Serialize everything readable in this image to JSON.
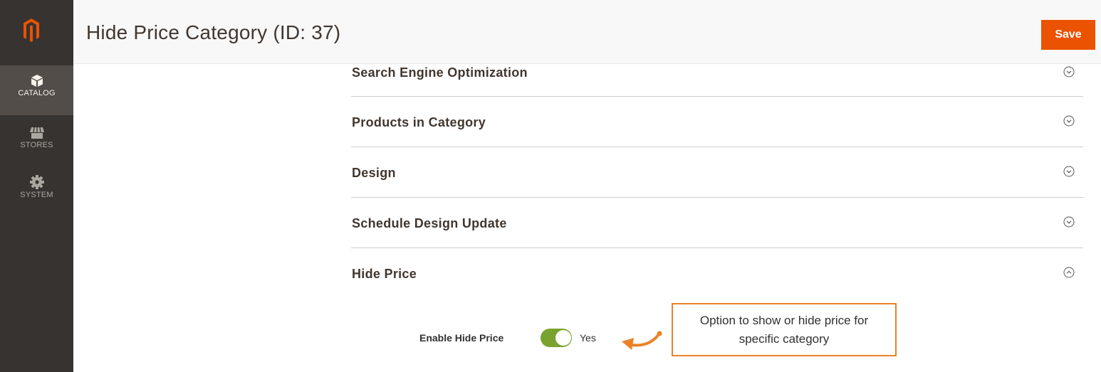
{
  "sidebar": {
    "items": [
      {
        "label": "CATALOG",
        "icon": "cube-icon",
        "active": true
      },
      {
        "label": "STORES",
        "icon": "store-icon",
        "active": false
      },
      {
        "label": "SYSTEM",
        "icon": "gear-icon",
        "active": false
      }
    ]
  },
  "header": {
    "title": "Hide Price Category (ID: 37)",
    "save_label": "Save"
  },
  "sections": [
    {
      "title": "Search Engine Optimization",
      "state": "collapsed"
    },
    {
      "title": "Products in Category",
      "state": "collapsed"
    },
    {
      "title": "Design",
      "state": "collapsed"
    },
    {
      "title": "Schedule Design Update",
      "state": "collapsed"
    },
    {
      "title": "Hide Price",
      "state": "expanded"
    }
  ],
  "hide_price": {
    "field_label": "Enable Hide Price",
    "toggle_value": "Yes",
    "toggle_on": true
  },
  "callout": {
    "line1": "Option to show or hide price for",
    "line2": "specific category"
  },
  "colors": {
    "accent": "#eb5202",
    "sidebar_bg": "#373330",
    "toggle_on": "#79a22e",
    "callout_border": "#eb8227"
  }
}
